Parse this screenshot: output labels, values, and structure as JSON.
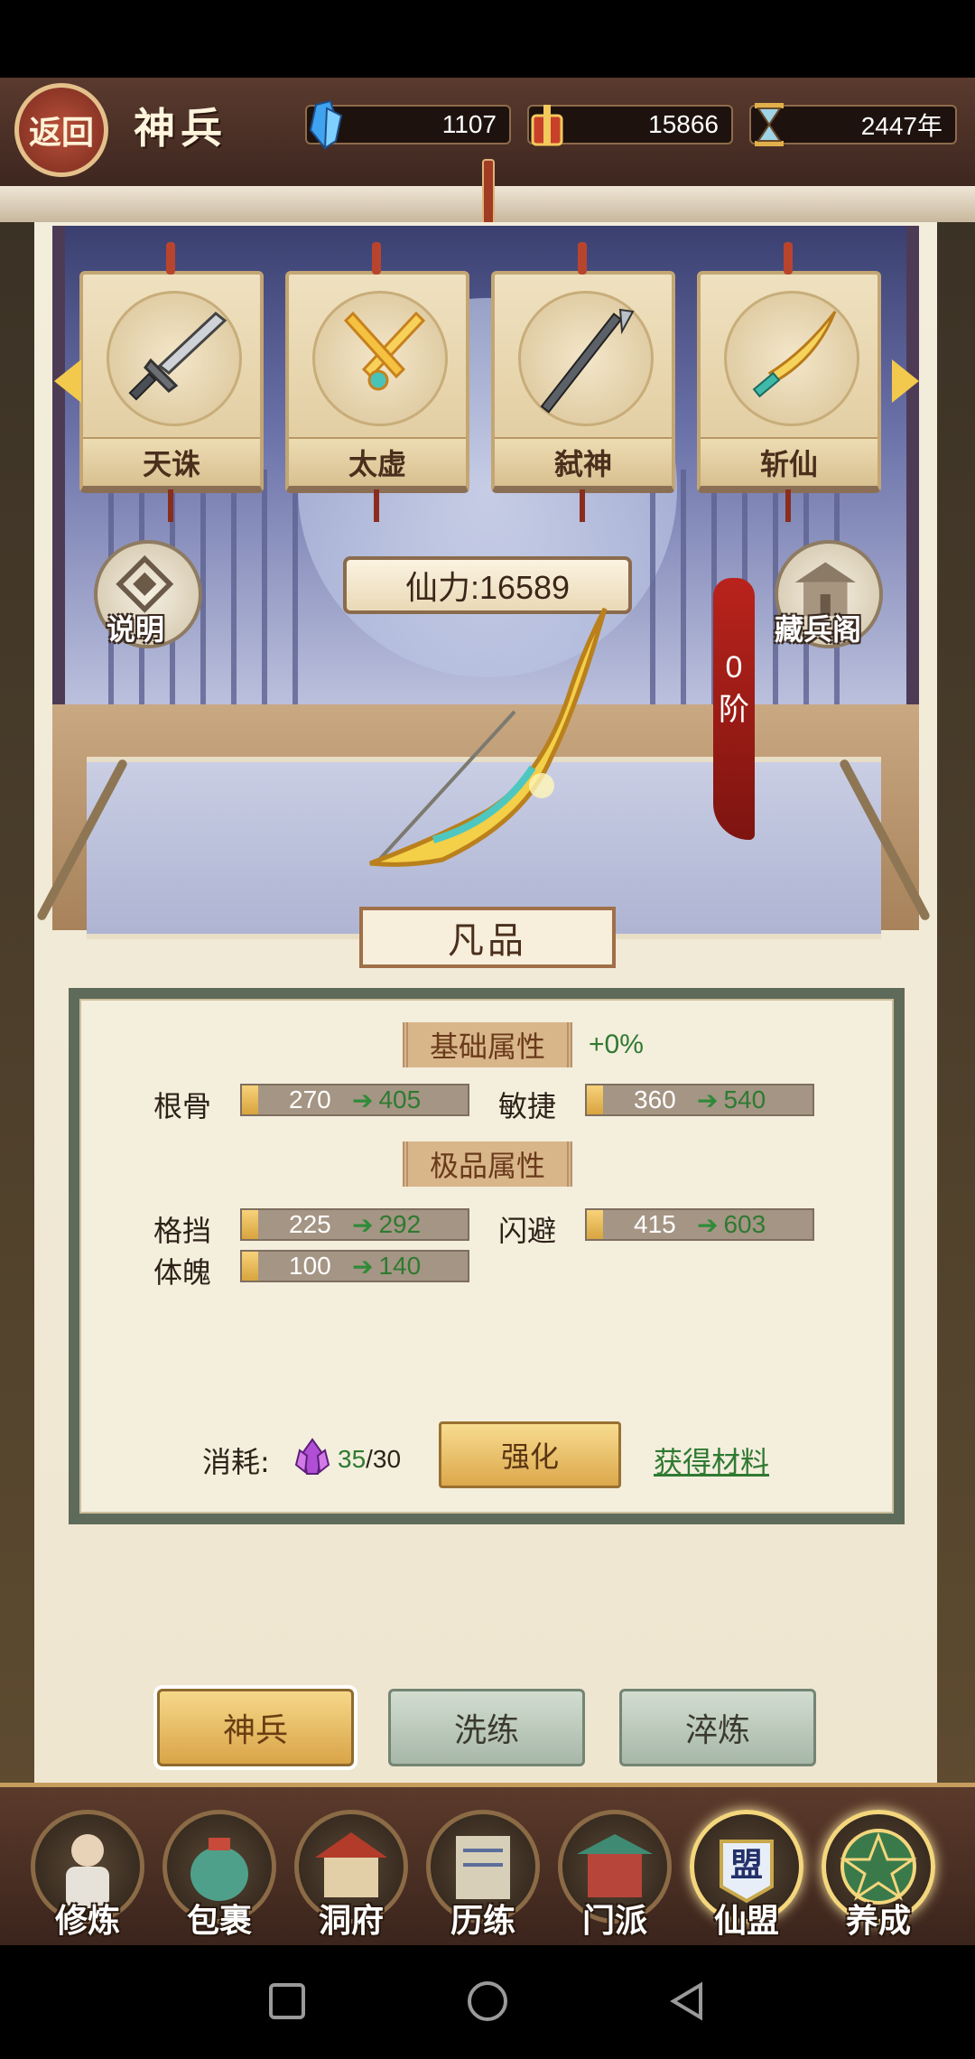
{
  "header": {
    "back_label": "返回",
    "title": "神兵",
    "resources": [
      {
        "icon": "crystal-icon",
        "value": "1107"
      },
      {
        "icon": "gift-box-icon",
        "value": "15866"
      },
      {
        "icon": "hourglass-icon",
        "value": "2447年"
      }
    ]
  },
  "weapons": [
    {
      "name": "天诛",
      "icon": "sword-icon"
    },
    {
      "name": "太虚",
      "icon": "twin-sword-icon"
    },
    {
      "name": "弑神",
      "icon": "spear-icon"
    },
    {
      "name": "斩仙",
      "icon": "sabre-icon"
    }
  ],
  "side_buttons": {
    "help_label": "说明",
    "armory_label": "藏兵阁"
  },
  "power_text": "仙力:16589",
  "stage": {
    "number": "0",
    "unit": "阶"
  },
  "grade": "凡品",
  "panel": {
    "base_title": "基础属性",
    "base_bonus": "+0%",
    "base_stats": [
      {
        "name": "根骨",
        "current": "270",
        "next": "405"
      },
      {
        "name": "敏捷",
        "current": "360",
        "next": "540"
      }
    ],
    "extra_title": "极品属性",
    "extra_stats": [
      {
        "name": "格挡",
        "current": "225",
        "next": "292"
      },
      {
        "name": "闪避",
        "current": "415",
        "next": "603"
      },
      {
        "name": "体魄",
        "current": "100",
        "next": "140"
      }
    ],
    "cost_label": "消耗:",
    "cost_have": "35",
    "cost_need": "/30",
    "enhance_label": "强化",
    "get_material_label": "获得材料"
  },
  "tabs": [
    {
      "label": "神兵",
      "active": true
    },
    {
      "label": "洗练",
      "active": false
    },
    {
      "label": "淬炼",
      "active": false
    }
  ],
  "nav": [
    {
      "label": "修炼"
    },
    {
      "label": "包裹"
    },
    {
      "label": "洞府"
    },
    {
      "label": "历练"
    },
    {
      "label": "门派"
    },
    {
      "label": "仙盟",
      "badge": "盟"
    },
    {
      "label": "养成"
    }
  ],
  "colors": {
    "accent_gold": "#d9a447",
    "green_value": "#2f7a31",
    "header_brown": "#4a2f25"
  }
}
